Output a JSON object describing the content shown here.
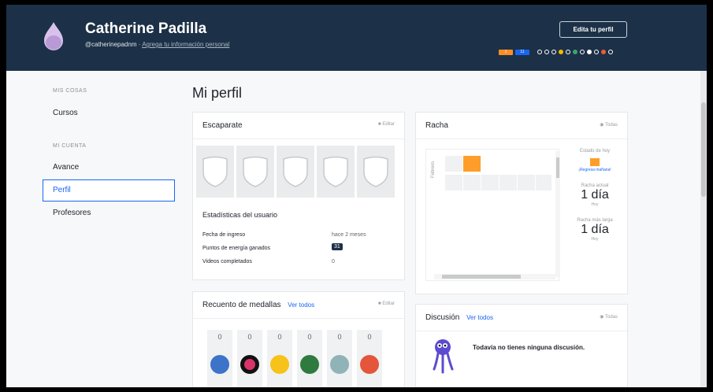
{
  "header": {
    "name": "Catherine Padilla",
    "username": "@catherinepadnm",
    "separator": "·",
    "add_info_link": "Agrega tu información personal",
    "edit_profile": "Edita tu perfil",
    "badge_counts": [
      "1",
      "11"
    ],
    "badge_colors": [
      "#ff8d27",
      "#1865f2"
    ],
    "dot_colors": [
      "#fff",
      "#fff",
      "#fff",
      "#f6b700",
      "#fff",
      "#3ea36e",
      "#fff",
      "#1c3147",
      "#fff",
      "#ef5b3a",
      "#fff"
    ]
  },
  "sidebar": {
    "section1": "MIS COSAS",
    "cursos": "Cursos",
    "section2": "MI CUENTA",
    "avance": "Avance",
    "perfil": "Perfil",
    "profesores": "Profesores"
  },
  "page_title": "Mi perfil",
  "escaparate": {
    "title": "Escaparate",
    "aside": "Editar",
    "stats_title": "Estadísticas del usuario",
    "rows": [
      {
        "label": "Fecha de ingreso",
        "value": "hace 2 meses"
      },
      {
        "label": "Puntos de energía ganados",
        "value": "31"
      },
      {
        "label": "Videos completados",
        "value": "0"
      }
    ]
  },
  "racha": {
    "title": "Racha",
    "aside": "Todas",
    "axis_label": "Febrero",
    "estado": "Estado de hoy",
    "regresa": "¡Regresa mañana!",
    "actual_label": "Racha actual",
    "actual_value": "1 día",
    "actual_sub": "Hoy",
    "larga_label": "Racha más larga",
    "larga_value": "1 día",
    "larga_sub": "Hoy",
    "accent": "#ff9d2a"
  },
  "medallas": {
    "title": "Recuento de medallas",
    "ver_todos": "Ver todos",
    "aside": "Editar",
    "counts": [
      "0",
      "0",
      "0",
      "0",
      "0",
      "0"
    ],
    "colors": [
      "#3d73c9",
      "#d9336b",
      "#f7c21a",
      "#2f7a3f",
      "#8fb3b6",
      "#e4553b"
    ]
  },
  "discusion": {
    "title": "Discusión",
    "ver_todos": "Ver todos",
    "aside": "Todas",
    "empty": "Todavía no tienes ninguna discusión."
  }
}
